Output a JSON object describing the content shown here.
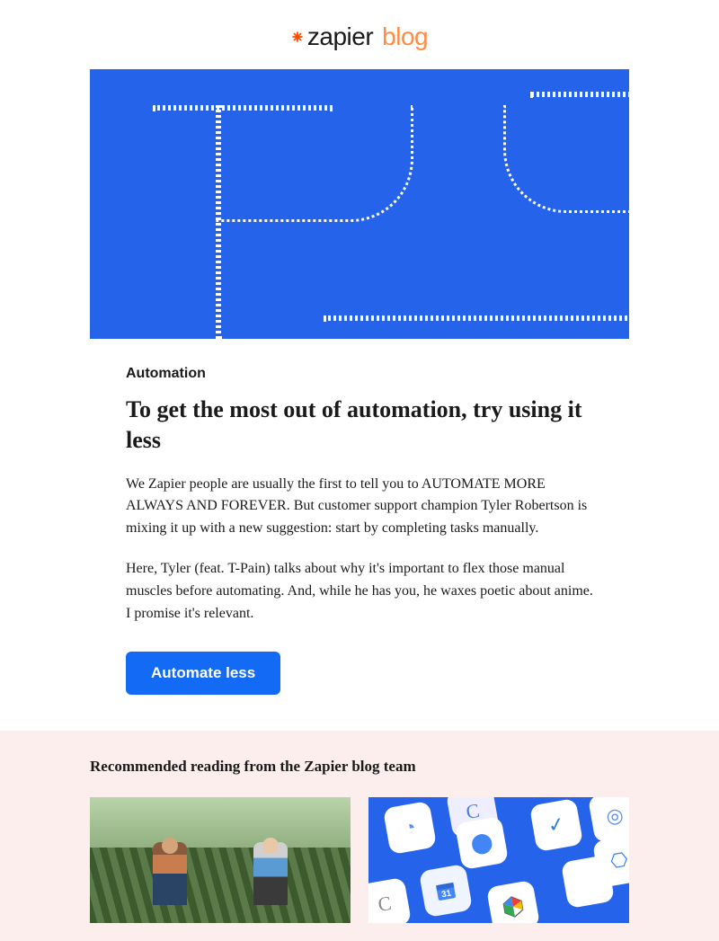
{
  "header": {
    "logo_text": "zapier",
    "logo_sub": "blog"
  },
  "article": {
    "category": "Automation",
    "title": "To get the most out of automation, try using it less",
    "paragraph1": "We Zapier people are usually the first to tell you to AUTOMATE MORE ALWAYS AND FOREVER. But customer support champion Tyler Robertson is mixing it up with a new suggestion: start by completing tasks manually.",
    "paragraph2": "Here, Tyler (feat. T-Pain) talks about why it's important to flex those manual muscles before automating. And, while he has you, he waxes poetic about anime. I promise it's relevant.",
    "cta_label": "Automate less"
  },
  "recommended": {
    "heading": "Recommended reading from the Zapier blog team"
  },
  "colors": {
    "accent_blue": "#136bf5",
    "accent_orange": "#ff8c42",
    "section_bg": "#fceeec"
  }
}
